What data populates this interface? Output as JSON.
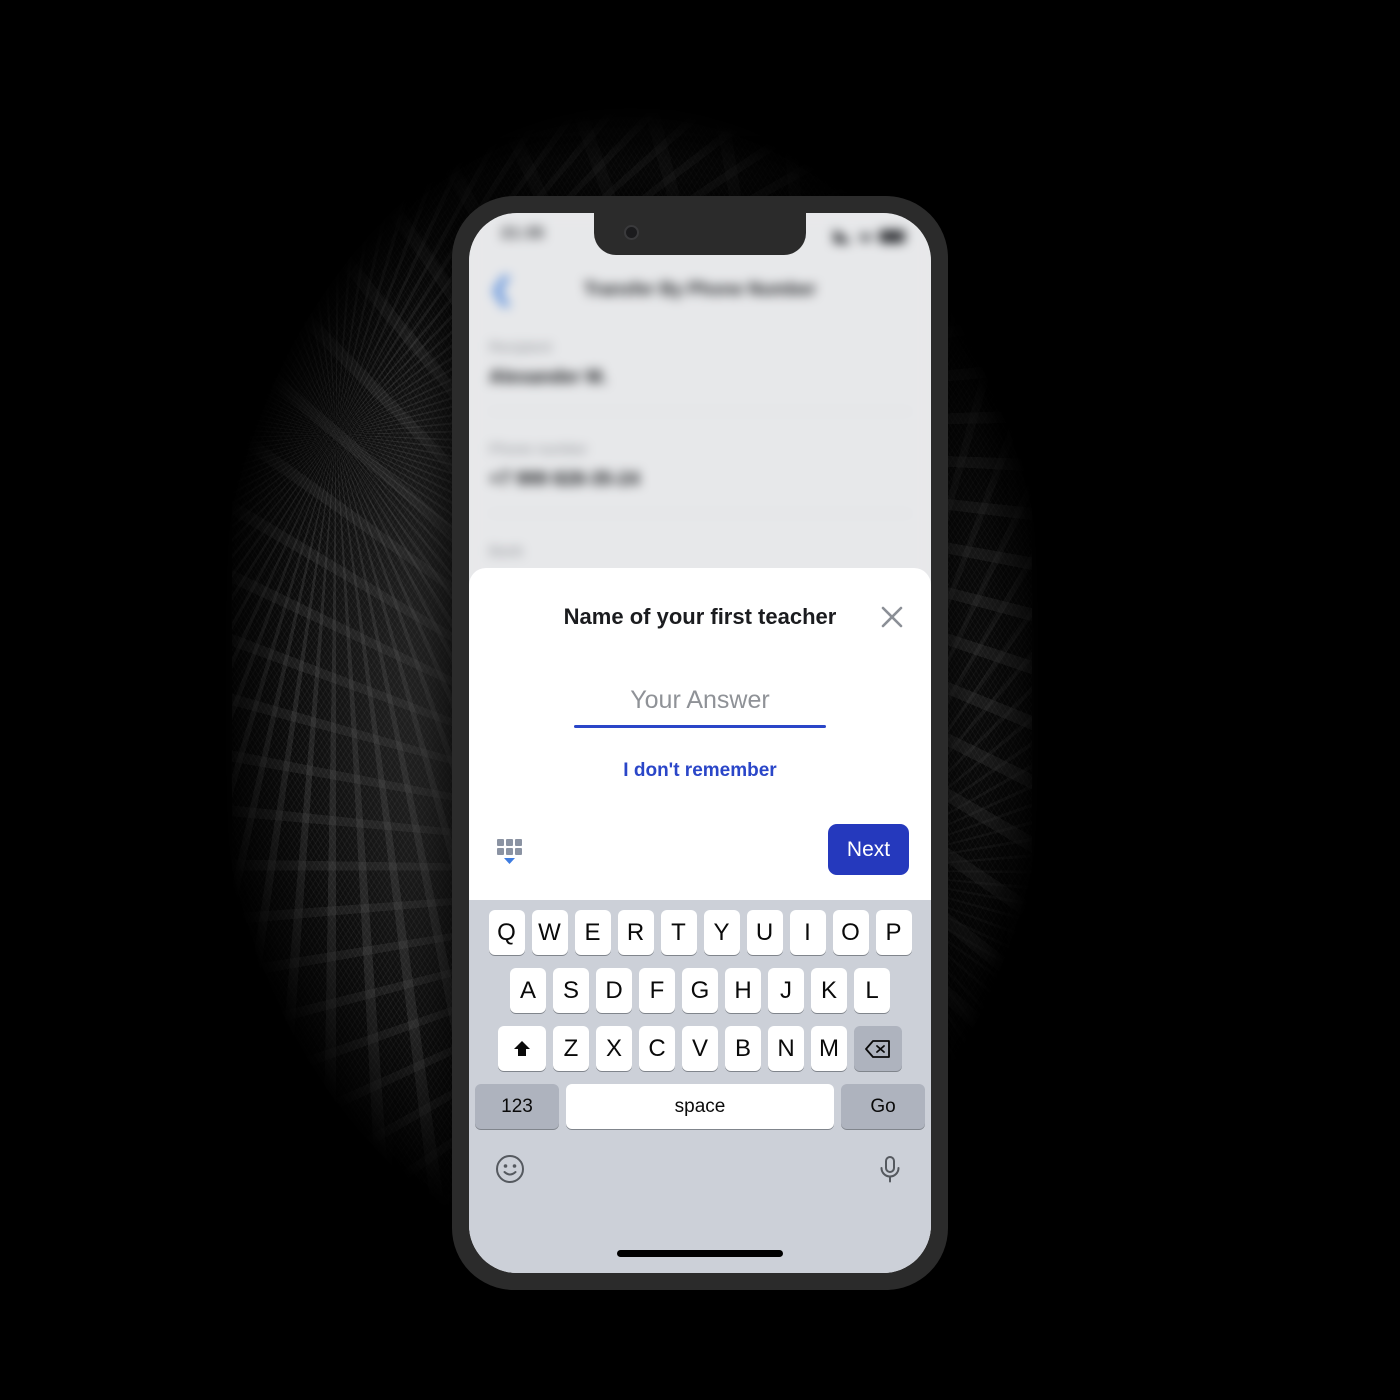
{
  "background_app": {
    "status_bar": {
      "time": "21:35",
      "icons": [
        "signal-icon",
        "wifi-icon",
        "battery-icon"
      ]
    },
    "nav": {
      "back_icon": "chevron-left-icon",
      "title": "Transfer By Phone Number"
    },
    "fields": [
      {
        "label": "Recipient",
        "value": "Alexander M."
      },
      {
        "label": "Phone number",
        "value": "+7 999 828-35-24"
      },
      {
        "label": "Bank",
        "value": ""
      }
    ]
  },
  "dialog": {
    "title": "Name of your first teacher",
    "close_icon": "close-icon",
    "answer": {
      "value": "",
      "placeholder": "Your Answer"
    },
    "forgot_link": "I don't remember",
    "hide_keyboard_icon": "keyboard-hide-icon",
    "next_label": "Next",
    "accent_color": "#2a46c8",
    "button_color": "#2539bd"
  },
  "keyboard": {
    "row1": [
      "Q",
      "W",
      "E",
      "R",
      "T",
      "Y",
      "U",
      "I",
      "O",
      "P"
    ],
    "row2": [
      "A",
      "S",
      "D",
      "F",
      "G",
      "H",
      "J",
      "K",
      "L"
    ],
    "row3": [
      "Z",
      "X",
      "C",
      "V",
      "B",
      "N",
      "M"
    ],
    "shift_icon": "shift-icon",
    "backspace_icon": "backspace-icon",
    "numbers_label": "123",
    "space_label": "space",
    "go_label": "Go",
    "emoji_icon": "emoji-icon",
    "mic_icon": "microphone-icon"
  }
}
